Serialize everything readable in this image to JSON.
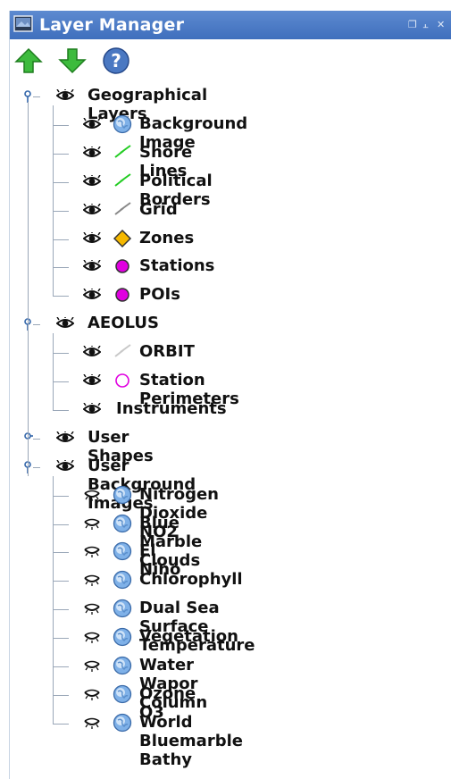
{
  "window": {
    "title": "Layer Manager",
    "controls": [
      "restore-icon",
      "pin-icon",
      "close-icon"
    ]
  },
  "toolbar": {
    "buttons": [
      {
        "name": "move-up-button",
        "icon": "green-up-arrow-icon"
      },
      {
        "name": "move-down-button",
        "icon": "green-down-arrow-icon"
      },
      {
        "name": "help-button",
        "icon": "question-mark-icon"
      }
    ]
  },
  "tree": {
    "groups": [
      {
        "label": "Geographical Layers",
        "visible": true,
        "expanded": true,
        "children": [
          {
            "label": "Background Image",
            "icon": "globe-icon",
            "visible": true
          },
          {
            "label": "Shore Lines",
            "icon": "green-line-icon",
            "visible": true
          },
          {
            "label": "Political Borders",
            "icon": "green-line-icon",
            "visible": true
          },
          {
            "label": "Grid",
            "icon": "gray-line-icon",
            "visible": true
          },
          {
            "label": "Zones",
            "icon": "orange-diamond-icon",
            "visible": true
          },
          {
            "label": "Stations",
            "icon": "magenta-dot-icon",
            "visible": true
          },
          {
            "label": "POIs",
            "icon": "magenta-dot-icon",
            "visible": true
          }
        ]
      },
      {
        "label": "AEOLUS",
        "visible": true,
        "expanded": true,
        "children": [
          {
            "label": "ORBIT",
            "icon": "light-gray-line-icon",
            "visible": true
          },
          {
            "label": "Station Perimeters",
            "icon": "magenta-ring-icon",
            "visible": true
          },
          {
            "label": "Instruments",
            "icon": "",
            "visible": true
          }
        ]
      },
      {
        "label": "User Shapes",
        "visible": true,
        "expanded": false,
        "children": []
      },
      {
        "label": "User Background Images",
        "visible": true,
        "expanded": true,
        "children": [
          {
            "label": "Nitrogen Dioxide NO2",
            "icon": "globe-icon",
            "visible": false
          },
          {
            "label": "Blue Marble Clouds",
            "icon": "globe-icon",
            "visible": false
          },
          {
            "label": "El Nino",
            "icon": "globe-icon",
            "visible": false
          },
          {
            "label": "Chlorophyll",
            "icon": "globe-icon",
            "visible": false
          },
          {
            "label": "Dual Sea Surface Temperature",
            "icon": "globe-icon",
            "visible": false
          },
          {
            "label": "Vegetation",
            "icon": "globe-icon",
            "visible": false
          },
          {
            "label": "Water Wapor Column",
            "icon": "globe-icon",
            "visible": false
          },
          {
            "label": "Ozone O3",
            "icon": "globe-icon",
            "visible": false
          },
          {
            "label": "World Bluemarble Bathy",
            "icon": "globe-icon",
            "visible": false
          }
        ]
      }
    ]
  },
  "colors": {
    "titlebar": "#4a79c6",
    "green_line": "#22cc22",
    "gray_line": "#888888",
    "light_gray_line": "#c8c8c8",
    "diamond": "#f5b800",
    "magenta": "#e000e0"
  }
}
